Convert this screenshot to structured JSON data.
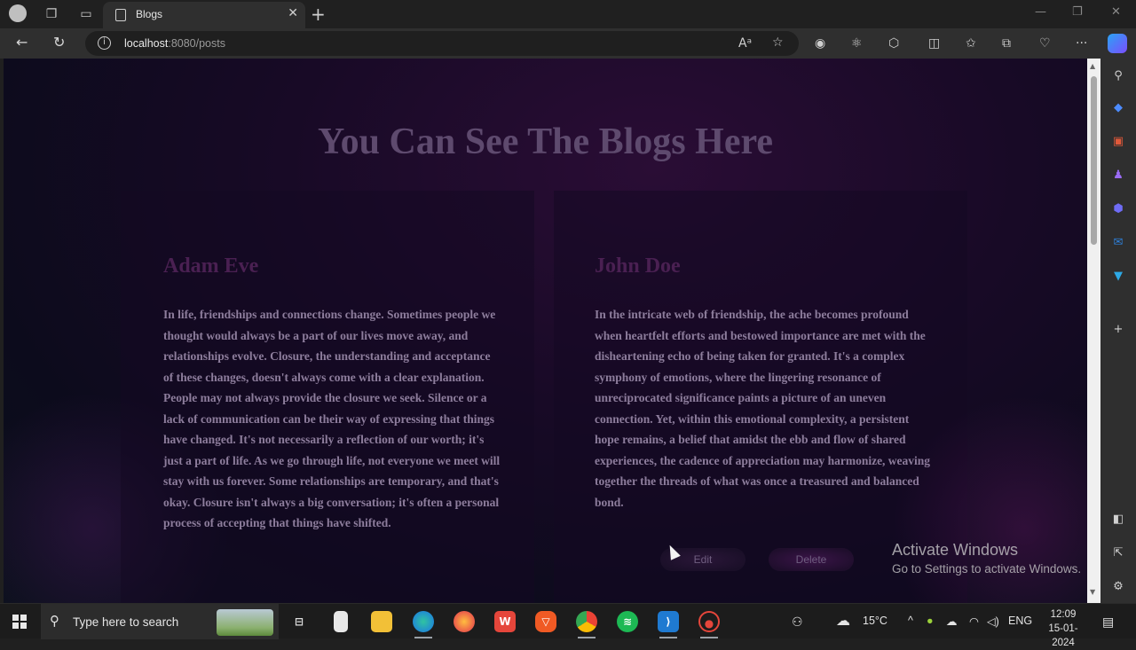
{
  "browser": {
    "tab_title": "Blogs",
    "url_host": "localhost",
    "url_rest": ":8080/posts"
  },
  "page": {
    "heading": "You Can See The Blogs Here",
    "posts": [
      {
        "author": "Adam Eve",
        "body": "In life, friendships and connections change. Sometimes people we thought would always be a part of our lives move away, and relationships evolve. Closure, the understanding and acceptance of these changes, doesn't always come with a clear explanation. People may not always provide the closure we seek. Silence or a lack of communication can be their way of expressing that things have changed. It's not necessarily a reflection of our worth; it's just a part of life. As we go through life, not everyone we meet will stay with us forever. Some relationships are temporary, and that's okay. Closure isn't always a big conversation; it's often a personal process of accepting that things have shifted."
      },
      {
        "author": "John Doe",
        "body": "In the intricate web of friendship, the ache becomes profound when heartfelt efforts and bestowed importance are met with the disheartening echo of being taken for granted. It's a complex symphony of emotions, where the lingering resonance of unreciprocated significance paints a picture of an uneven connection. Yet, within this emotional complexity, a persistent hope remains, a belief that amidst the ebb and flow of shared experiences, the cadence of appreciation may harmonize, weaving together the threads of what was once a treasured and balanced bond.",
        "edit_label": "Edit",
        "delete_label": "Delete"
      }
    ]
  },
  "watermark": {
    "line1": "Activate Windows",
    "line2": "Go to Settings to activate Windows."
  },
  "taskbar": {
    "search_placeholder": "Type here to search",
    "weather": "15°C",
    "language": "ENG",
    "time": "12:09",
    "date": "15-01-2024"
  }
}
